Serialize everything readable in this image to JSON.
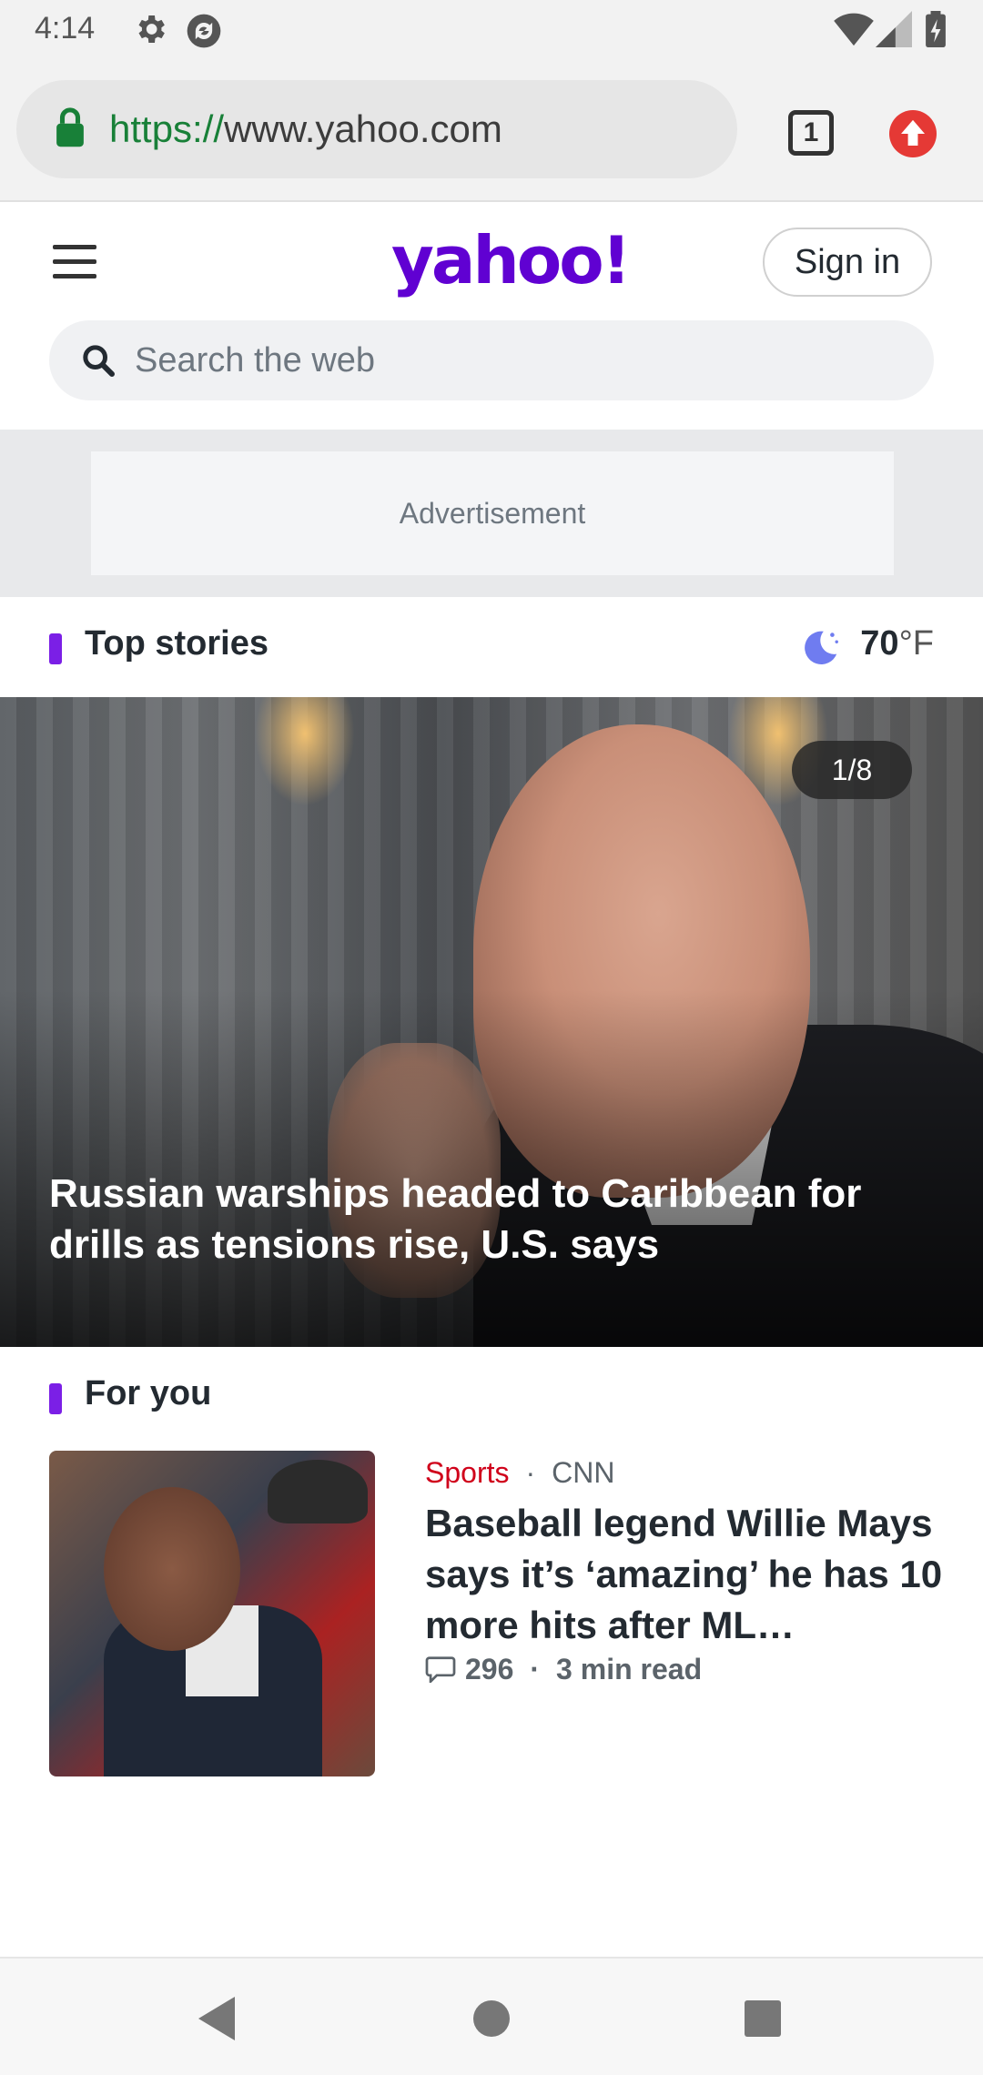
{
  "status_bar": {
    "time": "4:14",
    "icons": [
      "gear-icon",
      "sync-icon",
      "wifi-icon",
      "signal-icon",
      "battery-icon"
    ]
  },
  "browser": {
    "url_scheme": "https://",
    "url_host": "www.yahoo.com",
    "tab_count": "1",
    "icons": [
      "lock-icon",
      "tab-switcher-icon",
      "update-icon"
    ]
  },
  "header": {
    "logo": "yahoo!",
    "sign_in_label": "Sign in",
    "search_placeholder": "Search the web",
    "brand_color": "#6001d2"
  },
  "ad": {
    "label": "Advertisement"
  },
  "top_stories": {
    "title": "Top stories",
    "weather_temp": "70",
    "weather_unit": "°F",
    "weather_icon": "moon-icon",
    "hero": {
      "counter": "1/8",
      "headline": "Russian warships headed to Caribbean for drills as tensions rise, U.S. says"
    }
  },
  "for_you": {
    "title": "For you",
    "stories": [
      {
        "category": "Sports",
        "source": "CNN",
        "headline": "Baseball legend Willie Mays says it’s ‘amazing’ he has 10 more hits after ML…",
        "comments": "296",
        "read_time": "3 min read"
      }
    ]
  },
  "nav_bar": {
    "icons": [
      "back-icon",
      "home-icon",
      "recents-icon"
    ]
  }
}
